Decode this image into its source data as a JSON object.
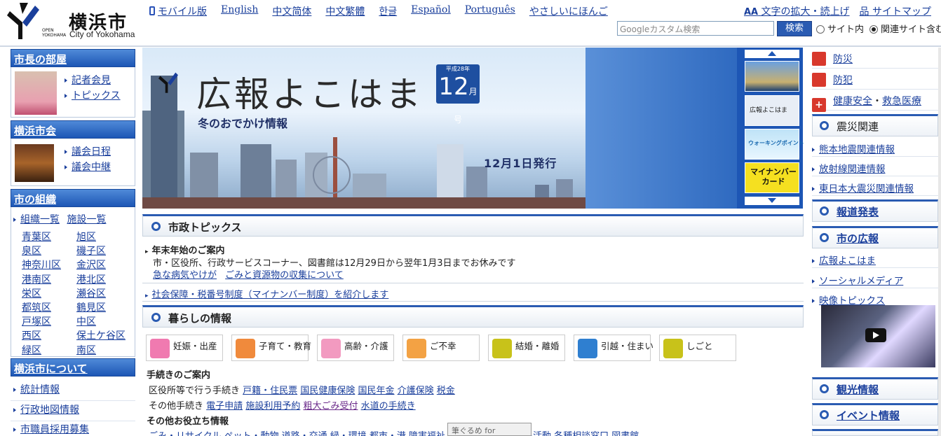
{
  "header": {
    "logo_open": "OPEN",
    "logo_brand": "YOKOHAMA",
    "city_name": "横浜市",
    "city_name_en": "City of Yokohama",
    "languages": [
      "モバイル版",
      "English",
      "中文简体",
      "中文繁體",
      "한글",
      "Español",
      "Português",
      "やさしいにほんご"
    ],
    "text_size_label": "文字の拡大・読上げ",
    "sitemap_label": "サイトマップ",
    "search_placeholder": "Googleカスタム検索",
    "search_button": "検索",
    "scope_site": "サイト内",
    "scope_related": "関連サイト含む"
  },
  "left": {
    "mayor": {
      "title": "市長の部屋",
      "links": [
        "記者会見",
        "トピックス"
      ]
    },
    "council": {
      "title": "横浜市会",
      "links": [
        "議会日程",
        "議会中継"
      ]
    },
    "org": {
      "title": "市の組織",
      "links": [
        "組織一覧",
        "施設一覧"
      ],
      "wards_col1": [
        "青葉区",
        "泉区",
        "神奈川区",
        "港南区",
        "栄区",
        "都筑区",
        "戸塚区",
        "西区",
        "緑区"
      ],
      "wards_col2": [
        "旭区",
        "磯子区",
        "金沢区",
        "港北区",
        "瀬谷区",
        "鶴見区",
        "中区",
        "保土ケ谷区",
        "南区"
      ]
    },
    "about": {
      "title": "横浜市について",
      "links": [
        "統計情報",
        "行政地図情報",
        "市職員採用募集"
      ]
    }
  },
  "banner": {
    "title": "広報よこはま",
    "issue_month": "12",
    "issue_unit": "月号",
    "issue_year": "平成28年",
    "subtitle": "冬のおでかけ情報",
    "date": "12月1日発行",
    "thumb_labels": [
      "広報よこはま",
      "ウォーキングポイント",
      "マイナンバーカード"
    ]
  },
  "topics": {
    "title": "市政トピックス",
    "item1_title": "年末年始のご案内",
    "item1_text": "市・区役所、行政サービスコーナー、図書館は12月29日から翌年1月3日までお休みです",
    "item1_links": [
      "急な病気やけが",
      "ごみと資源物の収集について"
    ],
    "item2": "社会保障・税番号制度（マイナンバー制度）を紹介します"
  },
  "life": {
    "title": "暮らしの情報",
    "categories": [
      {
        "label": "妊娠・出産",
        "color": "#f07ab0"
      },
      {
        "label": "子育て・教育",
        "color": "#f08a3c"
      },
      {
        "label": "高齢・介護",
        "color": "#f29ac0"
      },
      {
        "label": "ご不幸",
        "color": "#f3a244"
      },
      {
        "label": "結婚・離婚",
        "color": "#c8c21a"
      },
      {
        "label": "引越・住まい",
        "color": "#2f7fd0"
      },
      {
        "label": "しごと",
        "color": "#c8c21a"
      }
    ],
    "procedures_title": "手続きのご案内",
    "row1_label": "区役所等で行う手続き",
    "row1_links": [
      "戸籍・住民票",
      "国民健康保険",
      "国民年金",
      "介護保険",
      "税金"
    ],
    "row2_label": "その他手続き",
    "row2_links": [
      "電子申請",
      "施設利用予約",
      "粗大ごみ受付",
      "水道の手続き"
    ],
    "other_title": "その他お役立ち情報",
    "other_links": "ごみ・リサイクル ペット・動物 道路・交通 緑・環境 都市・港 障害福祉 文化・スポーツ 市民活動 各種相談窓口 図書館"
  },
  "right": {
    "safety": [
      {
        "label": "防災",
        "color": "#d8382c"
      },
      {
        "label": "防犯",
        "color": "#d8382c"
      }
    ],
    "health_a": "健康安全",
    "health_b": "救急医療",
    "health_sep": "・",
    "quake_title": "震災関連",
    "quake_links": [
      "熊本地震関連情報",
      "放射線関連情報",
      "東日本大震災関連情報"
    ],
    "press_title": "報道発表",
    "pr_title": "市の広報",
    "pr_links": [
      "広報よこはま",
      "ソーシャルメディア",
      "映像トピックス"
    ],
    "tourism_title": "観光情報",
    "event_title": "イベント情報"
  },
  "tooltip": "筆ぐるめ for Windows"
}
